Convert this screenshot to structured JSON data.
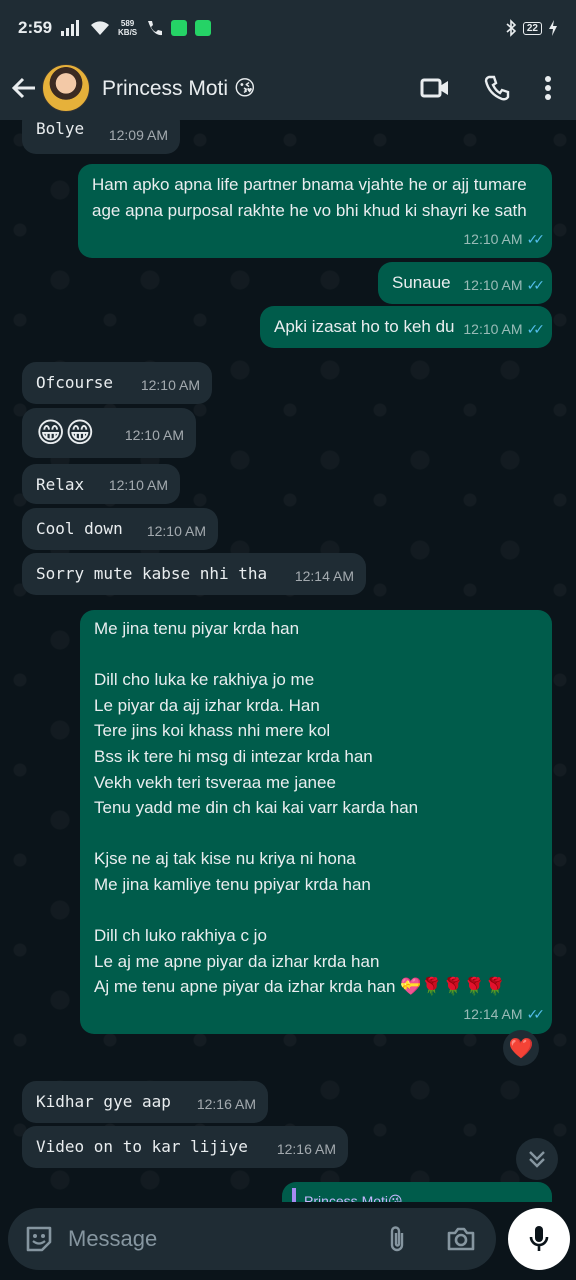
{
  "status_bar": {
    "time": "2:59",
    "speed_value": "589",
    "speed_unit": "KB/S",
    "battery": "22"
  },
  "header": {
    "contact_name": "Princess Moti",
    "contact_emoji": "😘"
  },
  "messages": [
    {
      "text": "Bolye",
      "time": "12:09 AM"
    },
    {
      "text": "Ham apko apna life partner bnama vjahte he or ajj tumare age apna purposal rakhte he vo bhi khud ki shayri ke sath",
      "time": "12:10 AM"
    },
    {
      "text": "Sunaue",
      "time": "12:10 AM"
    },
    {
      "text": "Apki izasat ho to keh du",
      "time": "12:10 AM"
    },
    {
      "text": "Ofcourse",
      "time": "12:10 AM"
    },
    {
      "text": "😁😁",
      "time": "12:10 AM"
    },
    {
      "text": "Relax",
      "time": "12:10 AM"
    },
    {
      "text": "Cool down",
      "time": "12:10 AM"
    },
    {
      "text": "Sorry mute kabse nhi tha",
      "time": "12:14 AM"
    },
    {
      "text": "Me jina tenu piyar krda han\n\nDill cho luka ke rakhiya jo me\nLe piyar da ajj izhar krda. Han\n Tere jins koi khass nhi mere kol\nBss ik tere hi msg di intezar krda han\nVekh vekh teri tsveraa me janee\nTenu yadd me din ch kai kai varr karda han\n\nKjse ne aj tak kise nu kriya ni hona\nMe jina kamliye tenu ppiyar krda han\n\n Dill ch luko rakhiya c jo\nLe aj me apne piyar da izhar krda han\nAj me tenu apne piyar da izhar krda han 💝🌹🌹🌹🌹",
      "time": "12:14 AM",
      "reaction": "❤️"
    },
    {
      "text": "Kidhar gye aap",
      "time": "12:16 AM"
    },
    {
      "text": "Video on to kar lijiye",
      "time": "12:16 AM"
    },
    {
      "text": "Princess Moti😘"
    }
  ],
  "composer": {
    "placeholder": "Message"
  },
  "colors": {
    "incoming": "#1f2c34",
    "outgoing": "#005c4b",
    "read_ticks": "#53bdeb",
    "background": "#0b141a"
  }
}
